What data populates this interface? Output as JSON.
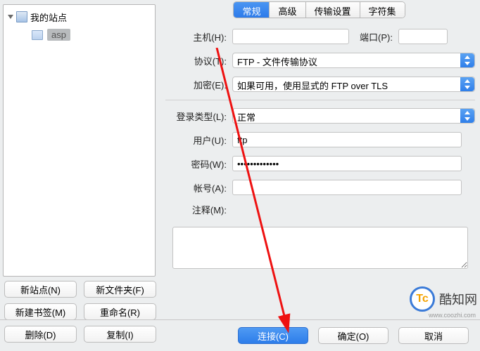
{
  "sidebar": {
    "root_label": "我的站点",
    "child_label": "asp",
    "buttons": {
      "new_site": "新站点(N)",
      "new_folder": "新文件夹(F)",
      "new_bookmark": "新建书签(M)",
      "rename": "重命名(R)",
      "delete": "删除(D)",
      "copy": "复制(I)"
    }
  },
  "tabs": {
    "general": "常规",
    "advanced": "高级",
    "transfer": "传输设置",
    "charset": "字符集"
  },
  "form": {
    "host_label": "主机(H):",
    "host_value": " ",
    "port_label": "端口(P):",
    "port_value": "",
    "protocol_label": "协议(T):",
    "protocol_value": "FTP - 文件传输协议",
    "encryption_label": "加密(E):",
    "encryption_value": "如果可用，使用显式的 FTP over TLS",
    "logintype_label": "登录类型(L):",
    "logintype_value": "正常",
    "user_label": "用户(U):",
    "user_value": "ftp",
    "password_label": "密码(W):",
    "password_value": "•••••••••••••",
    "account_label": "帐号(A):",
    "account_value": "",
    "comment_label": "注释(M):"
  },
  "footer": {
    "connect": "连接(C)",
    "ok": "确定(O)",
    "cancel": "取消"
  },
  "watermark": {
    "logo": "Tc",
    "brand": "酷知网",
    "url": "www.coozhi.com"
  }
}
